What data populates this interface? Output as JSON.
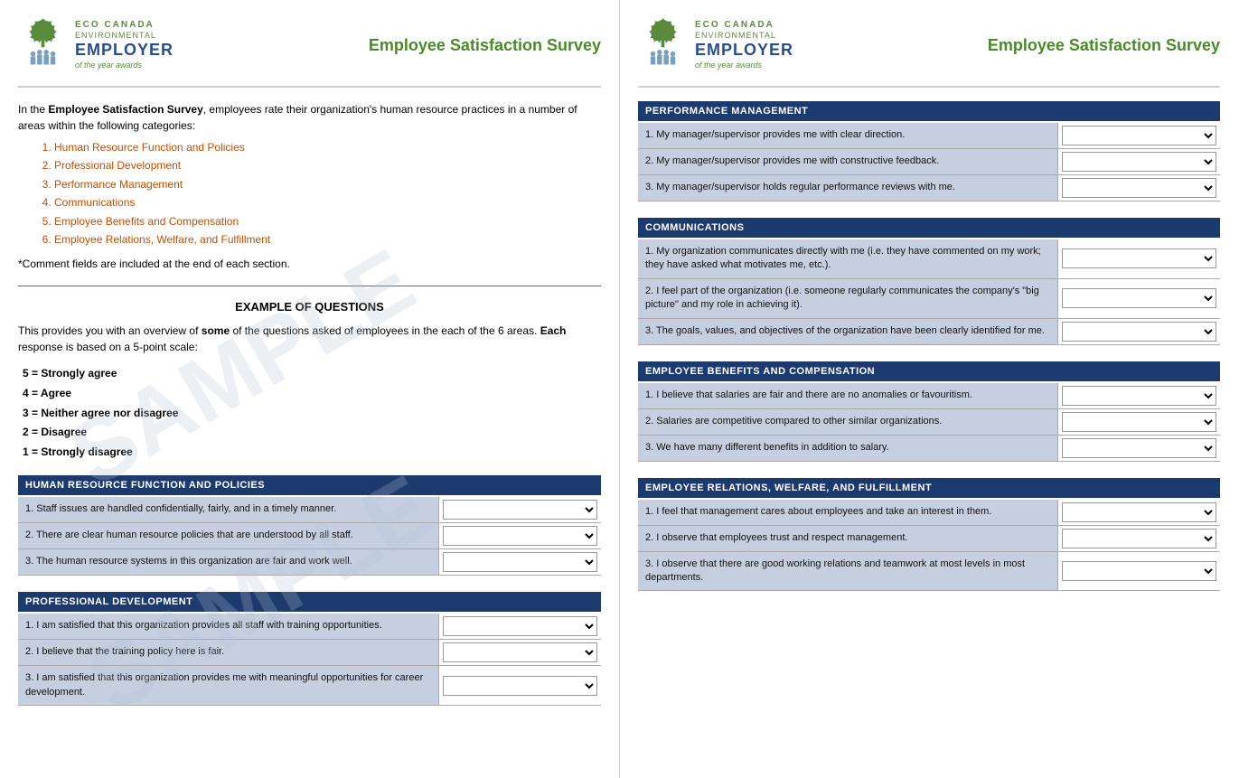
{
  "logo": {
    "eco": "ECO CANADA",
    "environmental": "ENVIRONMENTAL",
    "employer": "EMPLOYER",
    "year": "of the year awards"
  },
  "survey_title": "Employee Satisfaction Survey",
  "intro": {
    "text_before": "In the ",
    "bold_text": "Employee Satisfaction Survey",
    "text_after": ", employees rate their organization's human resource practices in a number of areas within the following categories:",
    "categories": [
      "Human Resource Function and Policies",
      "Professional Development",
      "Performance Management",
      "Communications",
      "Employee Benefits and Compensation",
      "Employee Relations, Welfare, and Fulfillment"
    ],
    "comment_note": "*Comment fields are included at the end of each section."
  },
  "example": {
    "heading": "EXAMPLE OF QUESTIONS",
    "text_before": "This provides you with an overview of ",
    "bold_some": "some",
    "text_mid": " of the questions asked of employees in the each of the 6 areas. ",
    "bold_each": "Each",
    "text_end": " response is based on a 5-point scale:",
    "scale": [
      "5 = Strongly agree",
      "4 = Agree",
      "3 = Neither agree nor disagree",
      "2 = Disagree",
      "1 = Strongly disagree"
    ]
  },
  "sections": [
    {
      "id": "hr-function",
      "header": "HUMAN RESOURCE FUNCTION AND POLICIES",
      "questions": [
        "1. Staff issues are handled confidentially, fairly, and in a timely manner.",
        "2. There are clear human resource policies that are understood by all staff.",
        "3. The human resource systems in this organization are fair and work well."
      ]
    },
    {
      "id": "professional-dev",
      "header": "PROFESSIONAL DEVELOPMENT",
      "questions": [
        "1. I am satisfied that this organization provides all staff with training opportunities.",
        "2. I believe that the training policy here is fair.",
        "3. I am satisfied that this organization provides me with meaningful opportunities for career development."
      ]
    }
  ],
  "right_sections": [
    {
      "id": "performance-mgmt",
      "header": "PERFORMANCE MANAGEMENT",
      "questions": [
        "1. My manager/supervisor provides me with clear direction.",
        "2. My manager/supervisor provides me with constructive feedback.",
        "3. My manager/supervisor holds regular performance reviews with me."
      ]
    },
    {
      "id": "communications",
      "header": "COMMUNICATIONS",
      "questions": [
        "1. My organization communicates directly with me (i.e. they have commented on my work; they have asked what motivates me, etc.).",
        "2. I feel part of the organization (i.e. someone regularly communicates the company's \"big picture\" and my role in achieving it).",
        "3. The goals, values, and objectives of the organization have been clearly identified for me."
      ]
    },
    {
      "id": "employee-benefits",
      "header": "EMPLOYEE BENEFITS AND COMPENSATION",
      "questions": [
        "1. I believe that salaries are fair and there are no anomalies or favouritism.",
        "2. Salaries are competitive compared to other similar organizations.",
        "3. We have many different benefits in addition to salary."
      ]
    },
    {
      "id": "employee-relations",
      "header": "EMPLOYEE RELATIONS, WELFARE, AND FULFILLMENT",
      "questions": [
        "1. I feel that management cares about employees and take an interest in them.",
        "2. I observe that employees trust and respect management.",
        "3. I observe that there are good working relations and teamwork at most levels in most departments."
      ]
    }
  ],
  "dropdown_options": [
    "",
    "1 - Strongly disagree",
    "2 - Disagree",
    "3 - Neither agree nor disagree",
    "4 - Agree",
    "5 - Strongly agree"
  ],
  "watermark": "SAMPLE"
}
